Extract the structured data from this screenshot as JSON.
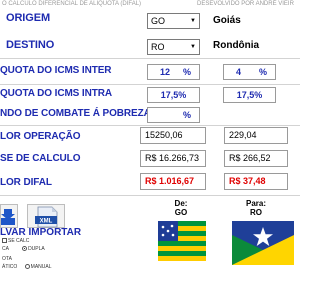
{
  "header": {
    "title": "O CALCULO DIFERENCIAL DE ALIQUOTA (DIFAL)",
    "credit": "DESEVOLVIDO POR ANDRÉ VIEIR"
  },
  "rows": {
    "origem": {
      "label": "ORIGEM",
      "selected": "GO",
      "state_name": "Goiás"
    },
    "destino": {
      "label": "DESTINO",
      "selected": "RO",
      "state_name": "Rondônia"
    },
    "aliq_inter": {
      "label": "QUOTA DO ICMS INTER",
      "origem": "12",
      "destino": "4",
      "unit": "%"
    },
    "aliq_intra": {
      "label": "QUOTA DO ICMS INTRA",
      "origem": "17,5%",
      "destino": "17,5%"
    },
    "fcp": {
      "label": "NDO DE COMBATE Á POBREZA",
      "unit": "%"
    },
    "valor_operacao": {
      "label": "LOR OPERAÇÃO",
      "origem": "15250,06",
      "destino": "229,04"
    },
    "base_calculo": {
      "label": "SE DE CALCULO",
      "origem": "R$ 16.266,73",
      "destino": "R$ 266,52"
    },
    "valor_difal": {
      "label": "LOR DIFAL",
      "origem": "R$ 1.016,67",
      "destino": "R$ 37,48"
    }
  },
  "actions": {
    "import_label": "LVAR  IMPORTAR",
    "xml_text": "XML"
  },
  "options": {
    "calc": "SE CALC",
    "simples": "CA",
    "dupla": "DUPLA",
    "ota": "OTA",
    "automatico": "ÁTICO",
    "manual": "MANUAL"
  },
  "flags": {
    "from_label": "De:",
    "from_value": "GO",
    "to_label": "Para:",
    "to_value": "RO",
    "go_colors": {
      "green": "#00943d",
      "yellow": "#ffcc00",
      "blue": "#1e3c96"
    },
    "ro_colors": {
      "green": "#0b8a3a",
      "yellow": "#ffd500",
      "blue": "#1f3f98"
    }
  },
  "colors": {
    "label_blue": "#1e2bb0",
    "difal_red": "#e00000"
  }
}
